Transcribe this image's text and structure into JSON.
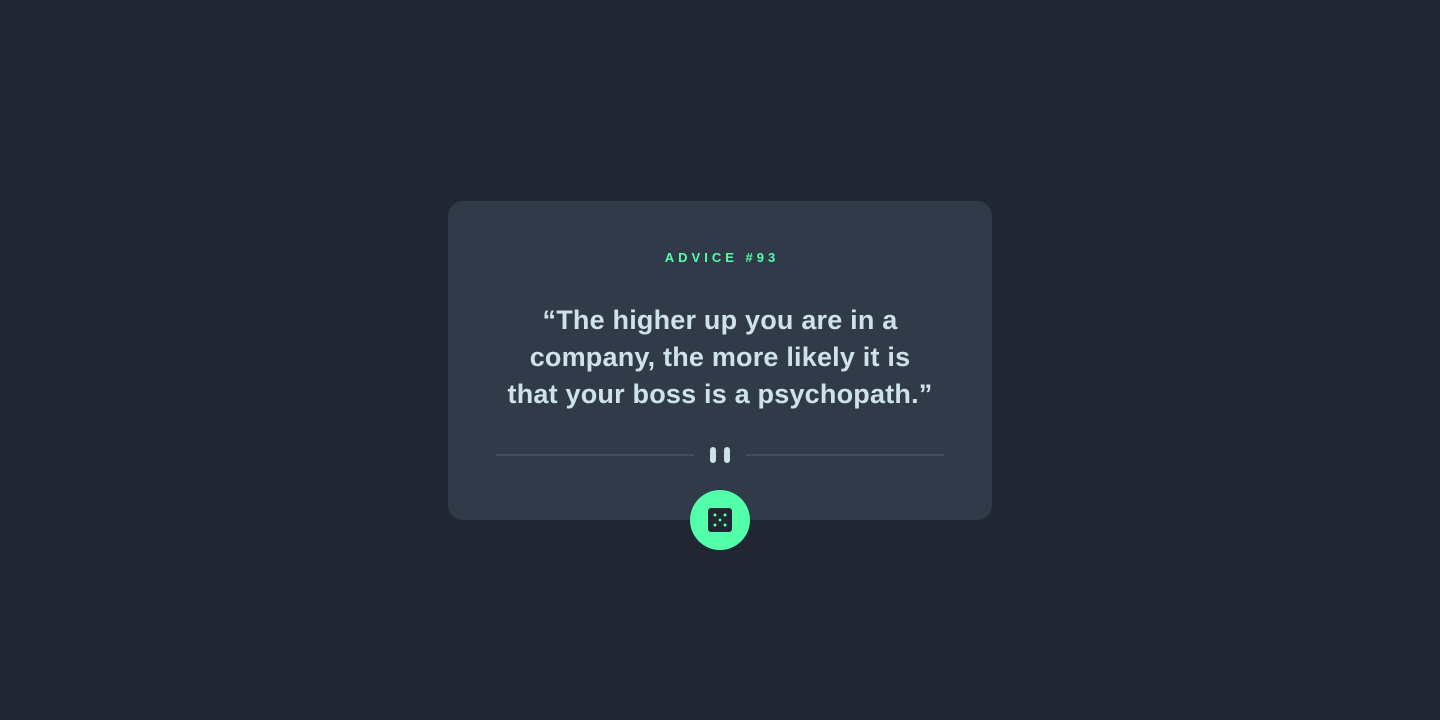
{
  "advice": {
    "id_label": "ADVICE #93",
    "text": "“The higher up you are in a company, the more likely it is that your boss is a psychopath.”"
  },
  "icons": {
    "divider": "pause-icon",
    "button": "dice-icon"
  },
  "colors": {
    "background": "#202632",
    "card": "#313a49",
    "accent": "#53ffaa",
    "text": "#cee3e9",
    "divider": "#4f5d74"
  }
}
